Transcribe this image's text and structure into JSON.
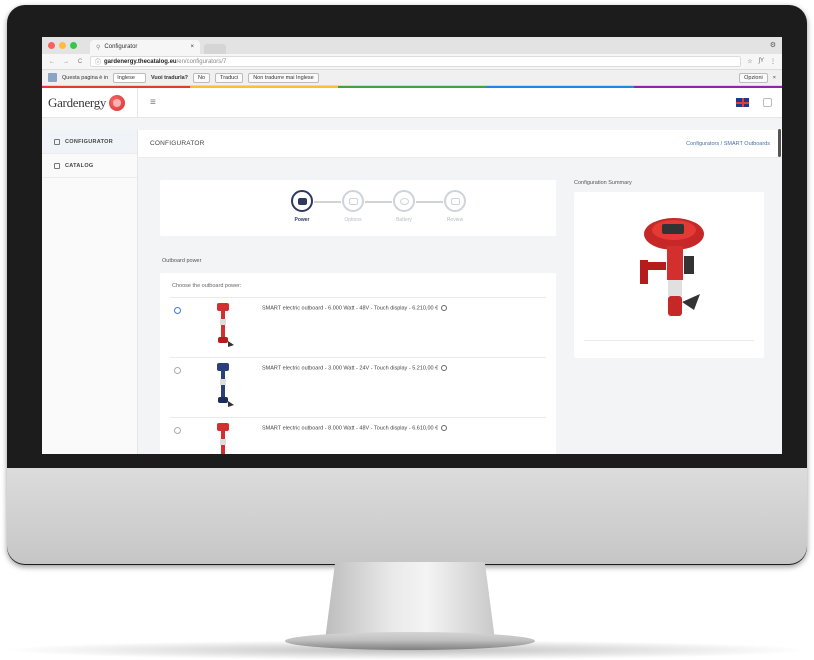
{
  "browser": {
    "tab_title": "Configurator",
    "tab_close": "×",
    "window_button": "⚙",
    "url_host": "gardenergy.thecatalog.eu",
    "url_path": "/en/configurators/7",
    "nav": {
      "back": "←",
      "forward": "→",
      "reload": "C",
      "lock": "ⓘ"
    },
    "addr_icons": {
      "star": "☆",
      "ext": "ʃY",
      "menu": "⋮"
    }
  },
  "translate": {
    "prompt": "Questa pagina è in",
    "source_lang": "Inglese",
    "question": "Vuoi tradurla?",
    "no_label": "No",
    "translate_label": "Traduci",
    "never_label": "Non tradurre mai Inglese",
    "options_label": "Opzioni",
    "close": "×"
  },
  "app": {
    "logo_text": "Gardenergy",
    "hamburger": "≡"
  },
  "sidebar": {
    "items": [
      {
        "label": "CONFIGURATOR"
      },
      {
        "label": "CATALOG"
      }
    ]
  },
  "page": {
    "title": "CONFIGURATOR",
    "breadcrumb": "Configurators / SMART Outboards"
  },
  "stepper": {
    "steps": [
      {
        "label": "Power",
        "active": true
      },
      {
        "label": "Options",
        "active": false
      },
      {
        "label": "Battery",
        "active": false
      },
      {
        "label": "Review",
        "active": false
      }
    ]
  },
  "outboard": {
    "section_label": "Outboard power",
    "choose_label": "Choose the outboard power:",
    "items": [
      {
        "text": "SMART electric outboard - 6.000 Watt - 48V - Touch display - 6.210,00 €",
        "color": "#d32f2f",
        "selected": true
      },
      {
        "text": "SMART electric outboard - 3.000 Watt - 24V - Touch display - 5.210,00 €",
        "color": "#2b3f7a",
        "selected": false
      },
      {
        "text": "SMART electric outboard - 8.000 Watt - 48V - Touch display - 6.610,00 €",
        "color": "#d32f2f",
        "selected": false
      }
    ]
  },
  "summary": {
    "label": "Configuration Summary"
  },
  "colors": {
    "accent": "#2d3a5c",
    "brand_red": "#d32f2f",
    "link": "#4a6fa5"
  }
}
